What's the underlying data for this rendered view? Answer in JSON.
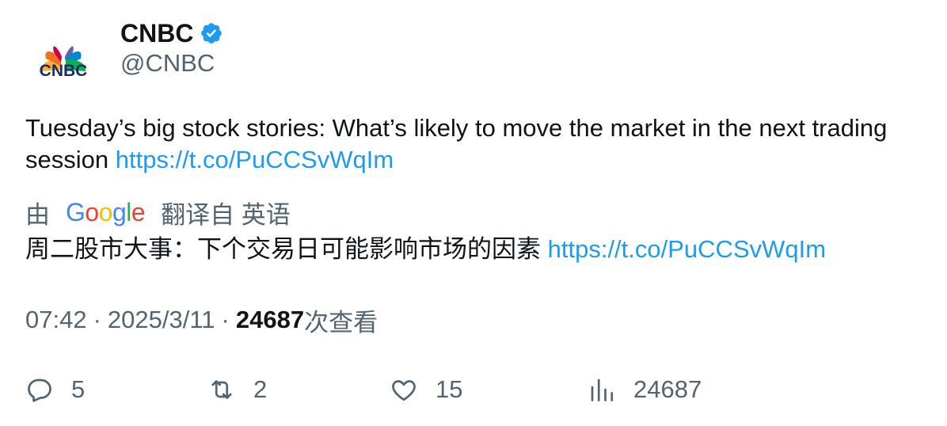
{
  "author": {
    "name": "CNBC",
    "handle": "@CNBC",
    "logo_text": "CNBC",
    "verified_icon": "verified-badge-icon"
  },
  "tweet": {
    "text": "Tuesday’s big stock stories: What’s likely to move the market in the next trading session ",
    "link": "https://t.co/PuCCSvWqIm"
  },
  "translation": {
    "by_label": "由",
    "provider_logo": "Google",
    "from_label": "翻译自 英语",
    "text": "周二股市大事：下个交易日可能影响市场的因素 ",
    "link": "https://t.co/PuCCSvWqIm"
  },
  "meta": {
    "time": "07:42",
    "date": "2025/3/11",
    "views_count": "24687",
    "views_label": "次查看"
  },
  "actions": {
    "replies": "5",
    "retweets": "2",
    "likes": "15",
    "views": "24687"
  },
  "colors": {
    "link": "#1d9bf0",
    "secondary_text": "#536471",
    "primary_text": "#0f1419",
    "verified": "#1d9bf0"
  }
}
